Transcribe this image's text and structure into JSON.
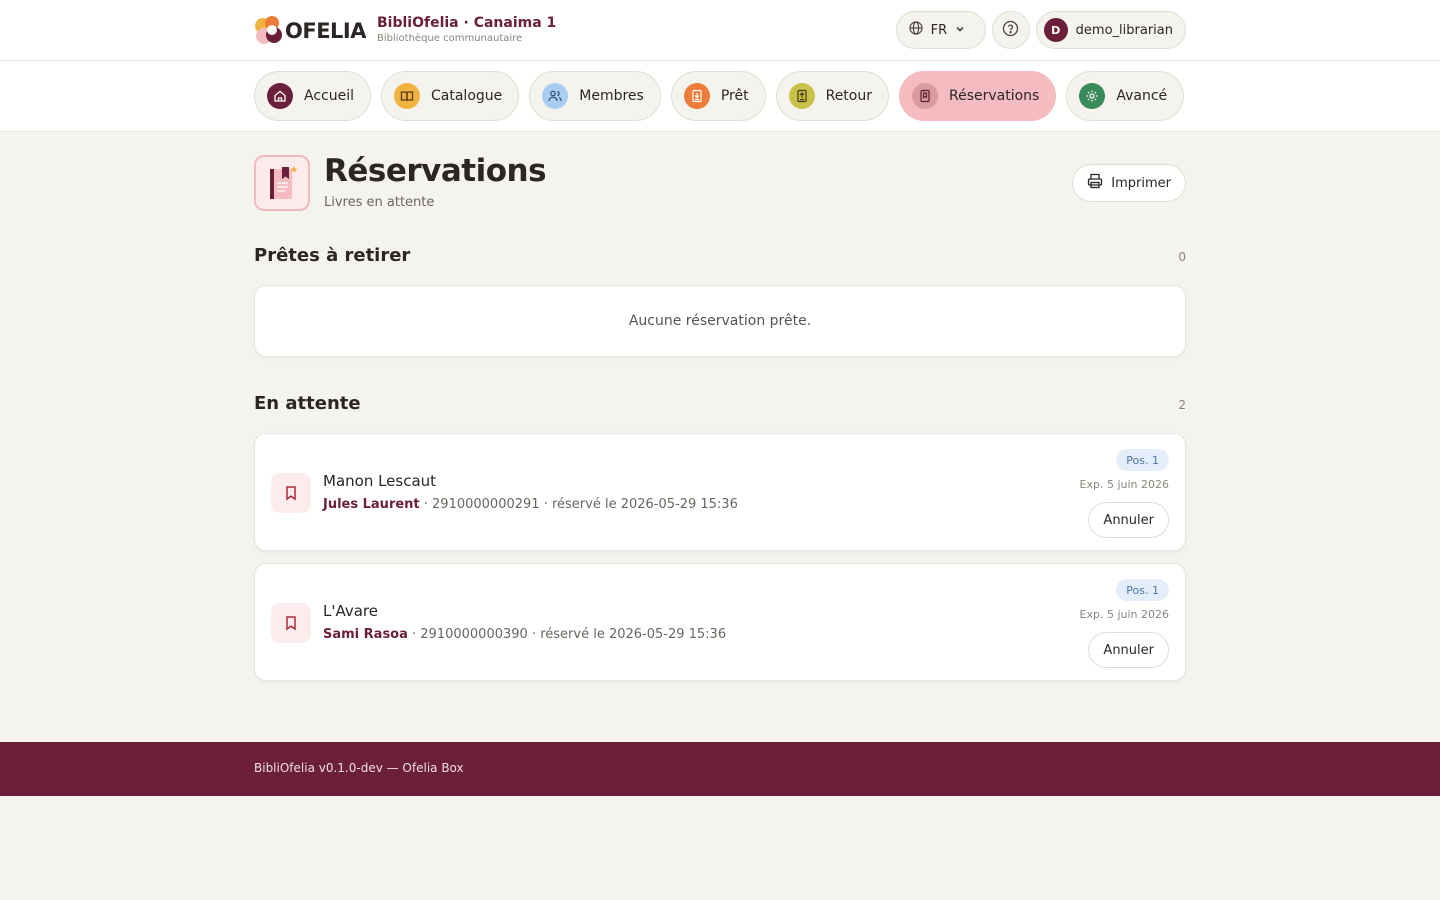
{
  "header": {
    "logo_text": "OFELIA",
    "title": "BibliOfelia · Canaima 1",
    "subtitle": "Bibliothèque communautaire",
    "language": "FR",
    "user": {
      "initial": "D",
      "name": "demo_librarian"
    }
  },
  "nav": {
    "items": [
      {
        "label": "Accueil",
        "icon": "home-icon",
        "color": "#6b1f3a"
      },
      {
        "label": "Catalogue",
        "icon": "book-open-icon",
        "color": "#f0b340"
      },
      {
        "label": "Membres",
        "icon": "users-icon",
        "color": "#a9cdf0"
      },
      {
        "label": "Prêt",
        "icon": "checkout-book-icon",
        "color": "#ee7c38"
      },
      {
        "label": "Retour",
        "icon": "return-book-icon",
        "color": "#c9c04a"
      },
      {
        "label": "Réservations",
        "icon": "bookmark-book-icon",
        "color": "#d99aa0",
        "active": true
      },
      {
        "label": "Avancé",
        "icon": "gear-icon",
        "color": "#3a8a5a"
      }
    ]
  },
  "page": {
    "title": "Réservations",
    "subtitle": "Livres en attente",
    "print_label": "Imprimer"
  },
  "ready": {
    "title": "Prêtes à retirer",
    "count": "0",
    "empty_text": "Aucune réservation prête."
  },
  "waiting": {
    "title": "En attente",
    "count": "2",
    "items": [
      {
        "title": "Manon Lescaut",
        "member": "Jules Laurent",
        "details": " · 2910000000291 · réservé le 2026-05-29 15:36",
        "position": "Pos. 1",
        "expiry": "Exp. 5 juin 2026",
        "cancel_label": "Annuler"
      },
      {
        "title": "L'Avare",
        "member": "Sami Rasoa",
        "details": " · 2910000000390 · réservé le 2026-05-29 15:36",
        "position": "Pos. 1",
        "expiry": "Exp. 5 juin 2026",
        "cancel_label": "Annuler"
      }
    ]
  },
  "footer": {
    "text": "BibliOfelia v0.1.0-dev — Ofelia Box"
  }
}
